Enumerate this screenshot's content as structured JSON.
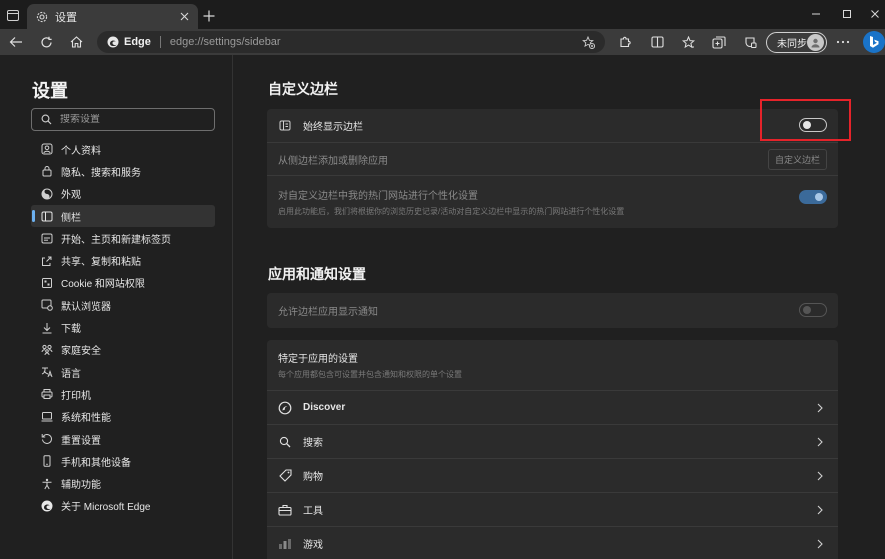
{
  "browser": {
    "tab_title": "设置",
    "address": {
      "site_label": "Edge",
      "url": "edge://settings/sidebar"
    },
    "profile_label": "未同步"
  },
  "sidebar": {
    "title": "设置",
    "search_placeholder": "搜索设置",
    "items": [
      {
        "label": "个人资料",
        "icon": "profile-icon"
      },
      {
        "label": "隐私、搜索和服务",
        "icon": "lock-icon"
      },
      {
        "label": "外观",
        "icon": "appearance-icon"
      },
      {
        "label": "侧栏",
        "icon": "sidebar-icon",
        "active": true
      },
      {
        "label": "开始、主页和新建标签页",
        "icon": "start-page-icon"
      },
      {
        "label": "共享、复制和粘贴",
        "icon": "share-icon"
      },
      {
        "label": "Cookie 和网站权限",
        "icon": "cookie-icon"
      },
      {
        "label": "默认浏览器",
        "icon": "default-browser-icon"
      },
      {
        "label": "下载",
        "icon": "download-icon"
      },
      {
        "label": "家庭安全",
        "icon": "family-icon"
      },
      {
        "label": "语言",
        "icon": "language-icon"
      },
      {
        "label": "打印机",
        "icon": "printer-icon"
      },
      {
        "label": "系统和性能",
        "icon": "system-icon"
      },
      {
        "label": "重置设置",
        "icon": "reset-icon"
      },
      {
        "label": "手机和其他设备",
        "icon": "phone-icon"
      },
      {
        "label": "辅助功能",
        "icon": "accessibility-icon"
      },
      {
        "label": "关于 Microsoft Edge",
        "icon": "edge-logo-icon"
      }
    ]
  },
  "main": {
    "customize_title": "自定义边栏",
    "always_show_label": "始终显示边栏",
    "always_show_on": false,
    "add_remove_label": "从侧边栏添加或删除应用",
    "customize_button": "自定义边栏",
    "personalize_label": "对自定义边栏中我的热门网站进行个性化设置",
    "personalize_sub": "启用此功能后，我们将根据你的浏览历史记录/活动对自定义边栏中显示的热门网站进行个性化设置",
    "personalize_on": true,
    "apps_title": "应用和通知设置",
    "allow_notify_label": "允许边栏应用显示通知",
    "app_specific_label": "特定于应用的设置",
    "app_specific_sub": "每个应用都包含可设置并包含通知和权限的单个设置",
    "apps": [
      {
        "label": "Discover",
        "icon": "discover-icon"
      },
      {
        "label": "搜索",
        "icon": "search-icon"
      },
      {
        "label": "购物",
        "icon": "shopping-tag-icon"
      },
      {
        "label": "工具",
        "icon": "toolbox-icon"
      },
      {
        "label": "游戏",
        "icon": "games-icon"
      }
    ]
  },
  "colors": {
    "accent": "#3b6a9a",
    "highlight": "#e5232a",
    "card": "#2b2b2b",
    "background": "#202020"
  }
}
